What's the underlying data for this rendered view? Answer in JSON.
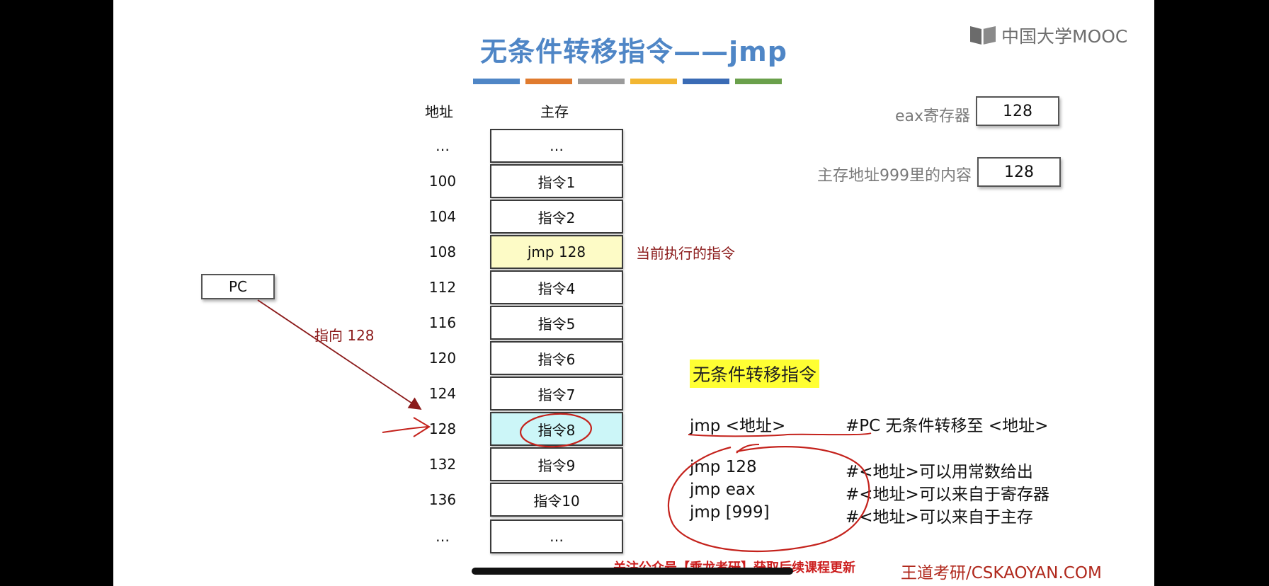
{
  "slide": {
    "title": "无条件转移指令——jmp",
    "logo_text": "中国大学MOOC",
    "accent_bars": [
      "#4f86c6",
      "#e07b2e",
      "#9b9b9b",
      "#f2b632",
      "#3a6bb5",
      "#6aa04b"
    ],
    "columns": {
      "address": "地址",
      "memory": "主存"
    },
    "memory_rows": [
      {
        "address": "…",
        "content": "…",
        "highlight": ""
      },
      {
        "address": "100",
        "content": "指令1",
        "highlight": ""
      },
      {
        "address": "104",
        "content": "指令2",
        "highlight": ""
      },
      {
        "address": "108",
        "content": "jmp 128",
        "highlight": "#fdfbc6"
      },
      {
        "address": "112",
        "content": "指令4",
        "highlight": ""
      },
      {
        "address": "116",
        "content": "指令5",
        "highlight": ""
      },
      {
        "address": "120",
        "content": "指令6",
        "highlight": ""
      },
      {
        "address": "124",
        "content": "指令7",
        "highlight": ""
      },
      {
        "address": "128",
        "content": "指令8",
        "highlight": "#ccf6f8"
      },
      {
        "address": "132",
        "content": "指令9",
        "highlight": ""
      },
      {
        "address": "136",
        "content": "指令10",
        "highlight": ""
      },
      {
        "address": "…",
        "content": "…",
        "highlight": ""
      }
    ],
    "current_instruction_label": "当前执行的指令",
    "registers": [
      {
        "label": "eax寄存器",
        "value": "128"
      },
      {
        "label": "主存地址999里的内容",
        "value": "128"
      }
    ],
    "pc": {
      "label": "PC",
      "arrow_label": "指向 128"
    },
    "section_title": "无条件转移指令",
    "syntax": {
      "code": "jmp <地址>",
      "comment": "#PC 无条件转移至 <地址>"
    },
    "examples": [
      {
        "code": "jmp 128",
        "comment": "#<地址>可以用常数给出"
      },
      {
        "code": "jmp eax",
        "comment": "#<地址>可以来自于寄存器"
      },
      {
        "code": "jmp [999]",
        "comment": "#<地址>可以来自于主存"
      }
    ],
    "footer_notice": "关注公众号【乘龙考研】获取后续课程更新",
    "footer_brand": "王道考研/CSKAOYAN.COM",
    "annotation_color": "#c4221c"
  }
}
